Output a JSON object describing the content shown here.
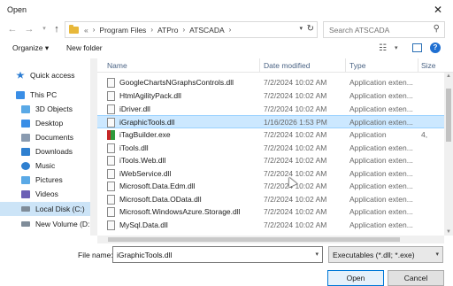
{
  "window": {
    "title": "Open"
  },
  "address": {
    "overflow": "«",
    "crumbs": [
      "Program Files",
      "ATPro",
      "ATSCADA"
    ]
  },
  "search": {
    "placeholder": "Search ATSCADA"
  },
  "toolbar": {
    "organize_label": "Organize ▾",
    "new_folder_label": "New folder"
  },
  "sidebar": {
    "items": [
      {
        "label": "Quick access",
        "icon": "star-icon",
        "color": "#2b7cd3"
      },
      {
        "label": "This PC",
        "icon": "computer-icon",
        "color": "#3a8ee6"
      },
      {
        "label": "3D Objects",
        "icon": "cube-icon",
        "color": "#5aa9e6"
      },
      {
        "label": "Desktop",
        "icon": "desktop-icon",
        "color": "#3a8ee6"
      },
      {
        "label": "Documents",
        "icon": "document-icon",
        "color": "#8a9bb0"
      },
      {
        "label": "Downloads",
        "icon": "download-icon",
        "color": "#2f80d0"
      },
      {
        "label": "Music",
        "icon": "music-icon",
        "color": "#2f80d0"
      },
      {
        "label": "Pictures",
        "icon": "picture-icon",
        "color": "#5aa9e6"
      },
      {
        "label": "Videos",
        "icon": "video-icon",
        "color": "#6b5fb5"
      },
      {
        "label": "Local Disk (C:)",
        "icon": "drive-icon",
        "color": "#7f8c99"
      },
      {
        "label": "New Volume (D:",
        "icon": "drive-icon",
        "color": "#7f8c99"
      }
    ]
  },
  "columns": {
    "name": "Name",
    "date": "Date modified",
    "type": "Type",
    "size": "Size"
  },
  "files": [
    {
      "name": "GoogleChartsNGraphsControls.dll",
      "date": "7/2/2024 10:02 AM",
      "type": "Application exten...",
      "size": "",
      "kind": "dll"
    },
    {
      "name": "HtmlAgilityPack.dll",
      "date": "7/2/2024 10:02 AM",
      "type": "Application exten...",
      "size": "",
      "kind": "dll"
    },
    {
      "name": "iDriver.dll",
      "date": "7/2/2024 10:02 AM",
      "type": "Application exten...",
      "size": "",
      "kind": "dll"
    },
    {
      "name": "iGraphicTools.dll",
      "date": "1/16/2026 1:53 PM",
      "type": "Application exten...",
      "size": "",
      "kind": "dll",
      "selected": true
    },
    {
      "name": "iTagBuilder.exe",
      "date": "7/2/2024 10:02 AM",
      "type": "Application",
      "size": "4,",
      "kind": "exe"
    },
    {
      "name": "iTools.dll",
      "date": "7/2/2024 10:02 AM",
      "type": "Application exten...",
      "size": "",
      "kind": "dll"
    },
    {
      "name": "iTools.Web.dll",
      "date": "7/2/2024 10:02 AM",
      "type": "Application exten...",
      "size": "",
      "kind": "dll"
    },
    {
      "name": "iWebService.dll",
      "date": "7/2/2024 10:02 AM",
      "type": "Application exten...",
      "size": "",
      "kind": "dll"
    },
    {
      "name": "Microsoft.Data.Edm.dll",
      "date": "7/2/2024 10:02 AM",
      "type": "Application exten...",
      "size": "",
      "kind": "dll"
    },
    {
      "name": "Microsoft.Data.OData.dll",
      "date": "7/2/2024 10:02 AM",
      "type": "Application exten...",
      "size": "",
      "kind": "dll"
    },
    {
      "name": "Microsoft.WindowsAzure.Storage.dll",
      "date": "7/2/2024 10:02 AM",
      "type": "Application exten...",
      "size": "",
      "kind": "dll"
    },
    {
      "name": "MySql.Data.dll",
      "date": "7/2/2024 10:02 AM",
      "type": "Application exten...",
      "size": "",
      "kind": "dll"
    }
  ],
  "footer": {
    "file_name_label": "File name:",
    "file_name_value": "iGraphicTools.dll",
    "filter_value": "Executables (*.dll; *.exe)",
    "open_label": "Open",
    "cancel_label": "Cancel"
  }
}
